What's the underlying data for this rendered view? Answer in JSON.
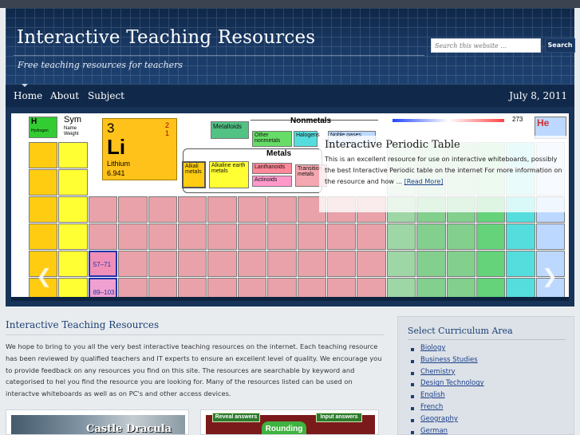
{
  "header": {
    "site_title": "Interactive Teaching Resources",
    "tagline": "Free teaching resources for teachers",
    "search_placeholder": "Search this website ...",
    "search_button": "Search"
  },
  "nav": {
    "items": [
      "Home",
      "About",
      "Subject"
    ],
    "date": "July 8, 2011"
  },
  "slider": {
    "title": "Interactive Periodic Table",
    "text": "This is an excellent resource for use on interactive whiteboards, possibly the best Interactive Periodic table on the internet For more information on the resource and how ...",
    "read_more": "[Read More]",
    "prev_arrow": "❮",
    "next_arrow": "❯",
    "periodic": {
      "legend_number": "3",
      "legend_symbol": "Li",
      "legend_name": "Lithium",
      "legend_mass": "6.941",
      "legend_right_top": "2",
      "legend_right_bottom": "1",
      "metalloids": "Metalloids",
      "nonmetals": "Nonmetals",
      "other_nonmetals": "Other nonmetals",
      "halogens": "Halogens",
      "noble": "Noble gases",
      "metals": "Metals",
      "alkali": "Alkali metals",
      "alkaline": "Alkaline earth metals",
      "lanthanoids": "Lanthanoids",
      "actinoids": "Actinoids",
      "transition": "Transition metals",
      "temp": "273",
      "row1_h": "H",
      "row1_h_name": "Hydrogen",
      "row1_sym": "Sym",
      "row1_name": "Name",
      "row1_weight": "Weight",
      "row1_he": "He",
      "lanthanide_range": "57–71",
      "actinide_range": "89–103"
    }
  },
  "content": {
    "title": "Interactive Teaching Resources",
    "text": "We hope to bring to you all the very best interactive teaching resources on the internet. Each teaching resource has been reviewed by qualified teachers and IT experts to ensure an excellent level of quality. We encourage you to provide feedback on any resources you find on this site. The resources are searchable by keyword and categorised to hel you find the resource you are looking for. Many of the resources listed can be used on interactve whiteboards as well as on PC's and other access devices.",
    "thumb1_caption": "Castle Dracula",
    "thumb2_reveal": "Reveal answers",
    "thumb2_input": "Input answers",
    "thumb2_big": "Rounding"
  },
  "sidebar": {
    "title": "Select Curriculum Area",
    "items": [
      "Biology",
      "Business Studies",
      "Chemistry",
      "Design Technology",
      "English",
      "French",
      "Geography",
      "German"
    ]
  },
  "colors": {
    "header_bg": "#1a3a66",
    "nav_bg": "#10294a",
    "accent_link": "#1a3f8a",
    "heading": "#1a3f73"
  }
}
